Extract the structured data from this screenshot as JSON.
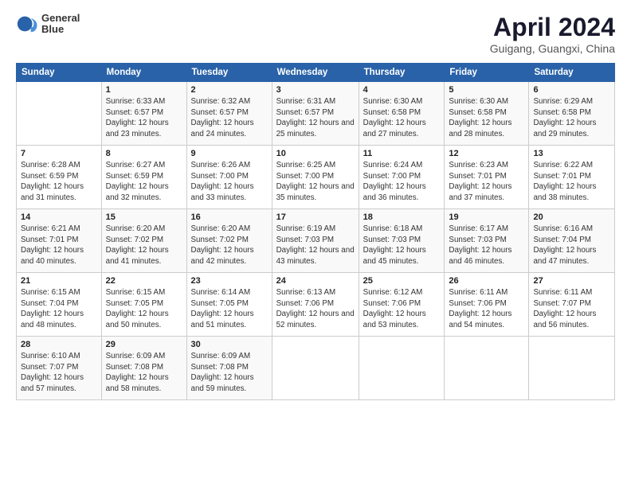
{
  "header": {
    "logo": {
      "line1": "General",
      "line2": "Blue"
    },
    "title": "April 2024",
    "location": "Guigang, Guangxi, China"
  },
  "calendar": {
    "days_of_week": [
      "Sunday",
      "Monday",
      "Tuesday",
      "Wednesday",
      "Thursday",
      "Friday",
      "Saturday"
    ],
    "weeks": [
      [
        {
          "day": "",
          "info": ""
        },
        {
          "day": "1",
          "info": "Sunrise: 6:33 AM\nSunset: 6:57 PM\nDaylight: 12 hours\nand 23 minutes."
        },
        {
          "day": "2",
          "info": "Sunrise: 6:32 AM\nSunset: 6:57 PM\nDaylight: 12 hours\nand 24 minutes."
        },
        {
          "day": "3",
          "info": "Sunrise: 6:31 AM\nSunset: 6:57 PM\nDaylight: 12 hours\nand 25 minutes."
        },
        {
          "day": "4",
          "info": "Sunrise: 6:30 AM\nSunset: 6:58 PM\nDaylight: 12 hours\nand 27 minutes."
        },
        {
          "day": "5",
          "info": "Sunrise: 6:30 AM\nSunset: 6:58 PM\nDaylight: 12 hours\nand 28 minutes."
        },
        {
          "day": "6",
          "info": "Sunrise: 6:29 AM\nSunset: 6:58 PM\nDaylight: 12 hours\nand 29 minutes."
        }
      ],
      [
        {
          "day": "7",
          "info": "Sunrise: 6:28 AM\nSunset: 6:59 PM\nDaylight: 12 hours\nand 31 minutes."
        },
        {
          "day": "8",
          "info": "Sunrise: 6:27 AM\nSunset: 6:59 PM\nDaylight: 12 hours\nand 32 minutes."
        },
        {
          "day": "9",
          "info": "Sunrise: 6:26 AM\nSunset: 7:00 PM\nDaylight: 12 hours\nand 33 minutes."
        },
        {
          "day": "10",
          "info": "Sunrise: 6:25 AM\nSunset: 7:00 PM\nDaylight: 12 hours\nand 35 minutes."
        },
        {
          "day": "11",
          "info": "Sunrise: 6:24 AM\nSunset: 7:00 PM\nDaylight: 12 hours\nand 36 minutes."
        },
        {
          "day": "12",
          "info": "Sunrise: 6:23 AM\nSunset: 7:01 PM\nDaylight: 12 hours\nand 37 minutes."
        },
        {
          "day": "13",
          "info": "Sunrise: 6:22 AM\nSunset: 7:01 PM\nDaylight: 12 hours\nand 38 minutes."
        }
      ],
      [
        {
          "day": "14",
          "info": "Sunrise: 6:21 AM\nSunset: 7:01 PM\nDaylight: 12 hours\nand 40 minutes."
        },
        {
          "day": "15",
          "info": "Sunrise: 6:20 AM\nSunset: 7:02 PM\nDaylight: 12 hours\nand 41 minutes."
        },
        {
          "day": "16",
          "info": "Sunrise: 6:20 AM\nSunset: 7:02 PM\nDaylight: 12 hours\nand 42 minutes."
        },
        {
          "day": "17",
          "info": "Sunrise: 6:19 AM\nSunset: 7:03 PM\nDaylight: 12 hours\nand 43 minutes."
        },
        {
          "day": "18",
          "info": "Sunrise: 6:18 AM\nSunset: 7:03 PM\nDaylight: 12 hours\nand 45 minutes."
        },
        {
          "day": "19",
          "info": "Sunrise: 6:17 AM\nSunset: 7:03 PM\nDaylight: 12 hours\nand 46 minutes."
        },
        {
          "day": "20",
          "info": "Sunrise: 6:16 AM\nSunset: 7:04 PM\nDaylight: 12 hours\nand 47 minutes."
        }
      ],
      [
        {
          "day": "21",
          "info": "Sunrise: 6:15 AM\nSunset: 7:04 PM\nDaylight: 12 hours\nand 48 minutes."
        },
        {
          "day": "22",
          "info": "Sunrise: 6:15 AM\nSunset: 7:05 PM\nDaylight: 12 hours\nand 50 minutes."
        },
        {
          "day": "23",
          "info": "Sunrise: 6:14 AM\nSunset: 7:05 PM\nDaylight: 12 hours\nand 51 minutes."
        },
        {
          "day": "24",
          "info": "Sunrise: 6:13 AM\nSunset: 7:06 PM\nDaylight: 12 hours\nand 52 minutes."
        },
        {
          "day": "25",
          "info": "Sunrise: 6:12 AM\nSunset: 7:06 PM\nDaylight: 12 hours\nand 53 minutes."
        },
        {
          "day": "26",
          "info": "Sunrise: 6:11 AM\nSunset: 7:06 PM\nDaylight: 12 hours\nand 54 minutes."
        },
        {
          "day": "27",
          "info": "Sunrise: 6:11 AM\nSunset: 7:07 PM\nDaylight: 12 hours\nand 56 minutes."
        }
      ],
      [
        {
          "day": "28",
          "info": "Sunrise: 6:10 AM\nSunset: 7:07 PM\nDaylight: 12 hours\nand 57 minutes."
        },
        {
          "day": "29",
          "info": "Sunrise: 6:09 AM\nSunset: 7:08 PM\nDaylight: 12 hours\nand 58 minutes."
        },
        {
          "day": "30",
          "info": "Sunrise: 6:09 AM\nSunset: 7:08 PM\nDaylight: 12 hours\nand 59 minutes."
        },
        {
          "day": "",
          "info": ""
        },
        {
          "day": "",
          "info": ""
        },
        {
          "day": "",
          "info": ""
        },
        {
          "day": "",
          "info": ""
        }
      ]
    ]
  }
}
